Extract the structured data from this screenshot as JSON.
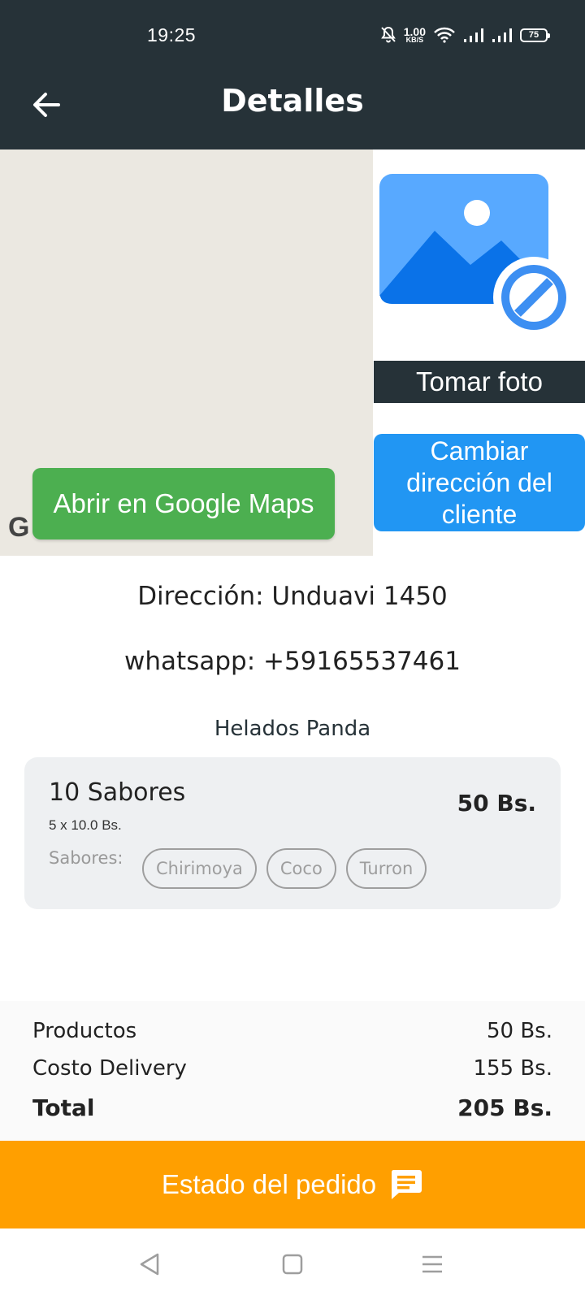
{
  "status_bar": {
    "time": "19:25",
    "net_speed_value": "1.00",
    "net_speed_unit": "KB/S",
    "battery": "75"
  },
  "app_bar": {
    "title": "Detalles"
  },
  "map": {
    "open_maps_label": "Abrir en Google Maps",
    "google_mark": "G"
  },
  "photo": {
    "take_photo_label": "Tomar foto",
    "change_address_label": "Cambiar dirección del cliente"
  },
  "details": {
    "address": "Dirección: Unduavi 1450",
    "whatsapp": "whatsapp: +59165537461",
    "store": "Helados Panda"
  },
  "product": {
    "name": "10 Sabores",
    "quantity_line": "5 x 10.0 Bs.",
    "price": "50 Bs.",
    "flavors_label": "Sabores:",
    "flavors": [
      "Chirimoya",
      "Coco",
      "Turron"
    ]
  },
  "summary": {
    "products_label": "Productos",
    "products_value": "50 Bs.",
    "delivery_label": "Costo Delivery",
    "delivery_value": "155 Bs.",
    "total_label": "Total",
    "total_value": "205 Bs."
  },
  "order_status": {
    "label": "Estado del pedido"
  },
  "colors": {
    "app_bar": "#263238",
    "maps_button": "#4caf50",
    "change_address_button": "#2196f3",
    "order_status_button": "#ff9f00"
  }
}
